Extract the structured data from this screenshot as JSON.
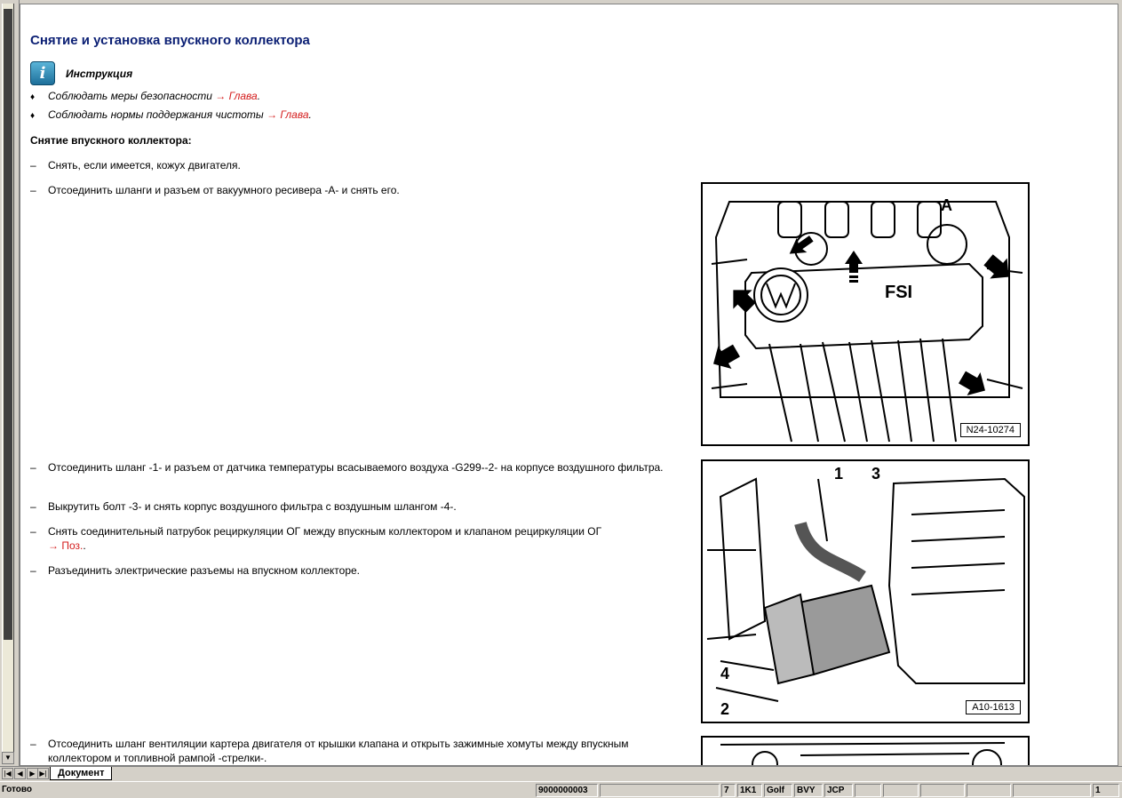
{
  "document": {
    "title": "Снятие и установка впускного коллектора",
    "info_label": "Инструкция",
    "bullets": [
      {
        "text": "Соблюдать меры безопасности ",
        "link": "→ Глава",
        "tail": "."
      },
      {
        "text": "Соблюдать нормы поддержания чистоты ",
        "link": "→ Глава",
        "tail": "."
      }
    ],
    "subheading": "Снятие впускного коллектора:",
    "steps": [
      {
        "text": "Снять, если имеется, кожух двигателя.",
        "link": ""
      },
      {
        "text": "Отсоединить шланги и разъем от вакуумного ресивера -A- и снять его.",
        "link": ""
      },
      {
        "text": "Отсоединить шланг -1- и разъем от датчика температуры всасываемого воздуха -G299--2- на корпусе воздушного фильтра.",
        "link": ""
      },
      {
        "text": "Выкрутить болт -3- и снять корпус воздушного фильтра с воздушным шлангом -4-.",
        "link": ""
      },
      {
        "text": "Снять соединительный патрубок рециркуляции ОГ между впускным коллектором и клапаном рециркуляции ОГ",
        "link": "→ Поз.",
        "tail": "."
      },
      {
        "text": "Разъединить электрические разъемы на впускном коллекторе.",
        "link": ""
      },
      {
        "text": "Отсоединить шланг вентиляции картера двигателя от крышки клапана и открыть зажимные хомуты между впускным коллектором и топливной рампой -стрелки-.",
        "link": ""
      }
    ],
    "figures": [
      {
        "id": "N24-10274",
        "labels": [
          "A"
        ],
        "cover_text": "FSI"
      },
      {
        "id": "A10-1613",
        "labels": [
          "1",
          "3",
          "4",
          "2"
        ]
      }
    ]
  },
  "tabs": {
    "active": "Документ"
  },
  "status": {
    "state": "Готово",
    "cells": [
      "9000000003",
      "7",
      "1K1",
      "Golf",
      "BVY",
      "JCP",
      "1"
    ]
  },
  "colors": {
    "heading": "#0b1f74",
    "link": "#d41d1d"
  }
}
